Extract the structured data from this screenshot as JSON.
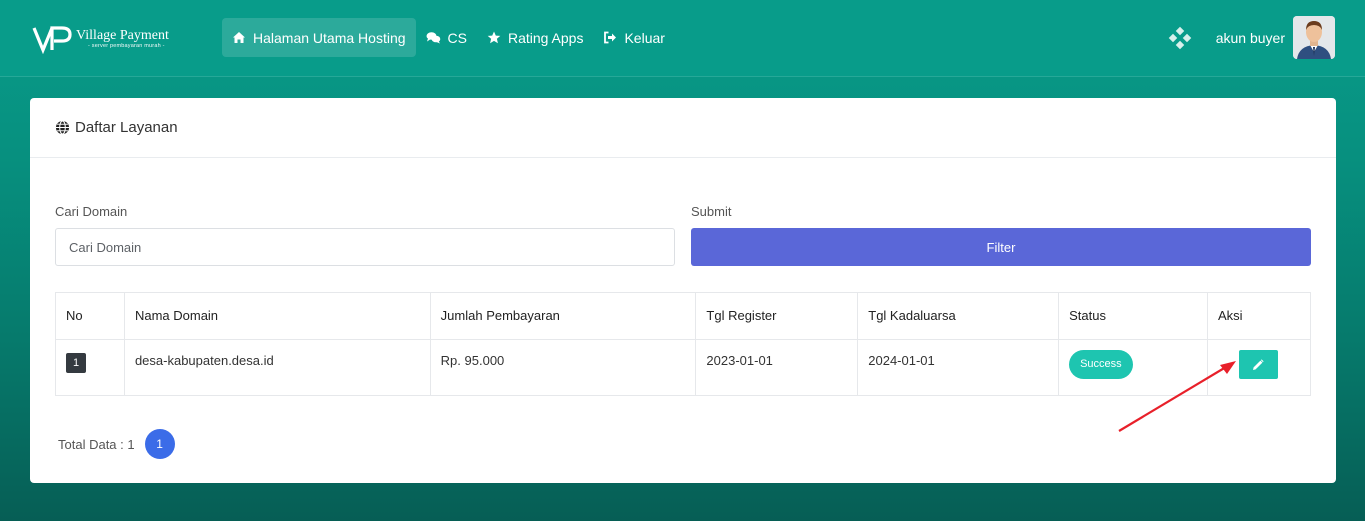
{
  "brand": {
    "name": "Village Payment",
    "tagline": "- server pembayaran murah -"
  },
  "nav": {
    "items": [
      {
        "label": "Halaman Utama Hosting",
        "icon": "home-icon",
        "active": true
      },
      {
        "label": "CS",
        "icon": "comments-icon",
        "active": false
      },
      {
        "label": "Rating Apps",
        "icon": "star-icon",
        "active": false
      },
      {
        "label": "Keluar",
        "icon": "sign-out-icon",
        "active": false
      }
    ],
    "user": "akun buyer"
  },
  "card": {
    "title": "Daftar Layanan"
  },
  "filter": {
    "domain_label": "Cari Domain",
    "domain_placeholder": "Cari Domain",
    "submit_label": "Submit",
    "button_label": "Filter"
  },
  "table": {
    "headers": [
      "No",
      "Nama Domain",
      "Jumlah Pembayaran",
      "Tgl Register",
      "Tgl Kadaluarsa",
      "Status",
      "Aksi"
    ],
    "rows": [
      {
        "no": "1",
        "domain": "desa-kabupaten.desa.id",
        "amount": "Rp. 95.000",
        "registered": "2023-01-01",
        "expires": "2024-01-01",
        "status": "Success"
      }
    ]
  },
  "footer": {
    "total": "Total Data : 1",
    "page": "1"
  },
  "colors": {
    "primary": "#089c8a",
    "accent": "#5a67d8",
    "success": "#1ec5b0",
    "page": "#3b6ce8",
    "arrow": "#e8202a"
  }
}
